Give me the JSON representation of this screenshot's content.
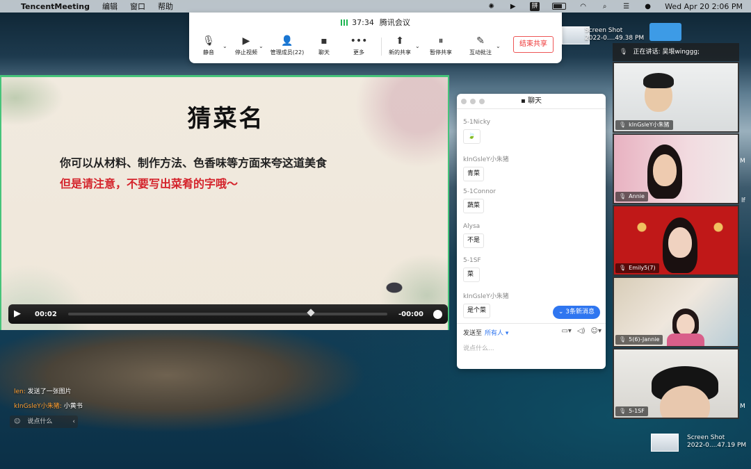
{
  "menubar": {
    "apple": "",
    "app_name": "TencentMeeting",
    "menus": [
      "编辑",
      "窗口",
      "帮助"
    ],
    "ime": "拼",
    "datetime": "Wed Apr 20  2:06 PM"
  },
  "meeting": {
    "duration": "37:34",
    "title": "腾讯会议",
    "buttons": {
      "mute": "静音",
      "stop_video": "停止视频",
      "manage_members": "管理成员(22)",
      "chat": "聊天",
      "more": "更多",
      "new_share": "新的共享",
      "pause_share": "暂停共享",
      "annotate": "互动批注",
      "end_share": "结束共享"
    }
  },
  "slide": {
    "title": "猜菜名",
    "line1": "你可以从材料、制作方法、色香味等方面来夸这道美食",
    "line2": "但是请注意，不要写出菜肴的字哦～"
  },
  "media": {
    "current": "00:02",
    "remaining": "-00:00",
    "progress": 0.76
  },
  "chat": {
    "title": "聊天",
    "messages": [
      {
        "sender": "5-1Nicky",
        "text": "🍃"
      },
      {
        "sender": "kInGsleY小朱猪",
        "text": "青菜"
      },
      {
        "sender": "5-1Connor",
        "text": "蔬菜"
      },
      {
        "sender": "Alysa",
        "text": "不是"
      },
      {
        "sender": "5-1SF",
        "text": "菜"
      },
      {
        "sender": "kInGsleY小朱猪",
        "text": "是个菜"
      }
    ],
    "new_messages": "3条新消息",
    "send_to_label": "发送至",
    "send_to_target": "所有人",
    "input_placeholder": "说点什么..."
  },
  "video": {
    "speaking_label": "正在讲话: 吴垠winggg;",
    "tiles": [
      {
        "name": "kInGsleY小朱猪"
      },
      {
        "name": "Annie"
      },
      {
        "name": "Emily5(7)"
      },
      {
        "name": "5(6)-Jannie"
      },
      {
        "name": "5-1SF"
      }
    ]
  },
  "desktop": {
    "shot1_title": "Screen Shot",
    "shot1_sub": "2022-0....49.38 PM",
    "shot2_title": "Screen Shot",
    "shot2_sub": "2022-0....47.19 PM",
    "edge_m1": "M",
    "edge_lf": "lf",
    "edge_m2": "M"
  },
  "overlay_chat": {
    "line1_who": "len:",
    "line1_text": "发送了一张图片",
    "line2_who": "kInGsleY小朱猪:",
    "line2_text": "小黄书",
    "input_placeholder": "说点什么"
  },
  "colors": {
    "accent_blue": "#2f76f0",
    "end_share_red": "#e33333",
    "slide_red": "#d4232b",
    "share_border_green": "#46c47a"
  }
}
